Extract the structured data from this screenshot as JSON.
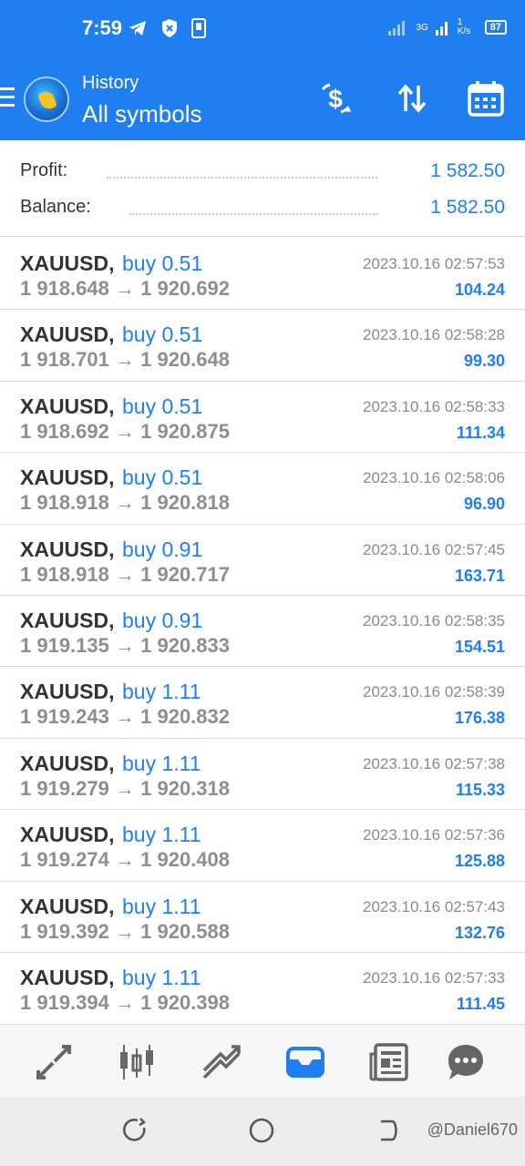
{
  "status_bar": {
    "time": "7:59",
    "network_speed": "1 K/s",
    "network_type": "3G",
    "battery": "87"
  },
  "app_bar": {
    "title": "History",
    "subtitle": "All symbols",
    "icons": [
      "menu-icon",
      "app-logo",
      "deals-filter-icon",
      "sort-icon",
      "calendar-icon"
    ]
  },
  "summary": {
    "profit_label": "Profit:",
    "profit_value": "1 582.50",
    "balance_label": "Balance:",
    "balance_value": "1 582.50"
  },
  "trades": [
    {
      "symbol": "XAUUSD,",
      "type": "buy 0.51",
      "open": "1 918.648",
      "arrow": "→",
      "close": "1 920.692",
      "time": "2023.10.16 02:57:53",
      "profit": "104.24"
    },
    {
      "symbol": "XAUUSD,",
      "type": "buy 0.51",
      "open": "1 918.701",
      "arrow": "→",
      "close": "1 920.648",
      "time": "2023.10.16 02:58:28",
      "profit": "99.30"
    },
    {
      "symbol": "XAUUSD,",
      "type": "buy 0.51",
      "open": "1 918.692",
      "arrow": "→",
      "close": "1 920.875",
      "time": "2023.10.16 02:58:33",
      "profit": "111.34"
    },
    {
      "symbol": "XAUUSD,",
      "type": "buy 0.51",
      "open": "1 918.918",
      "arrow": "→",
      "close": "1 920.818",
      "time": "2023.10.16 02:58:06",
      "profit": "96.90"
    },
    {
      "symbol": "XAUUSD,",
      "type": "buy 0.91",
      "open": "1 918.918",
      "arrow": "→",
      "close": "1 920.717",
      "time": "2023.10.16 02:57:45",
      "profit": "163.71"
    },
    {
      "symbol": "XAUUSD,",
      "type": "buy 0.91",
      "open": "1 919.135",
      "arrow": "→",
      "close": "1 920.833",
      "time": "2023.10.16 02:58:35",
      "profit": "154.51"
    },
    {
      "symbol": "XAUUSD,",
      "type": "buy 1.11",
      "open": "1 919.243",
      "arrow": "→",
      "close": "1 920.832",
      "time": "2023.10.16 02:58:39",
      "profit": "176.38"
    },
    {
      "symbol": "XAUUSD,",
      "type": "buy 1.11",
      "open": "1 919.279",
      "arrow": "→",
      "close": "1 920.318",
      "time": "2023.10.16 02:57:38",
      "profit": "115.33"
    },
    {
      "symbol": "XAUUSD,",
      "type": "buy 1.11",
      "open": "1 919.274",
      "arrow": "→",
      "close": "1 920.408",
      "time": "2023.10.16 02:57:36",
      "profit": "125.88"
    },
    {
      "symbol": "XAUUSD,",
      "type": "buy 1.11",
      "open": "1 919.392",
      "arrow": "→",
      "close": "1 920.588",
      "time": "2023.10.16 02:57:43",
      "profit": "132.76"
    },
    {
      "symbol": "XAUUSD,",
      "type": "buy 1.11",
      "open": "1 919.394",
      "arrow": "→",
      "close": "1 920.398",
      "time": "2023.10.16 02:57:33",
      "profit": "111.45"
    }
  ],
  "bottom_nav": [
    "quotes-icon",
    "chart-icon",
    "trade-icon",
    "history-icon",
    "news-icon",
    "chat-icon"
  ],
  "bottom_nav_active": "history-icon",
  "watermark": "@Daniel670",
  "colors": {
    "accent": "#1f7ff0",
    "active_nav": "#1f7ff0",
    "text_dark": "#333333",
    "text_muted": "#8e8e8e"
  }
}
